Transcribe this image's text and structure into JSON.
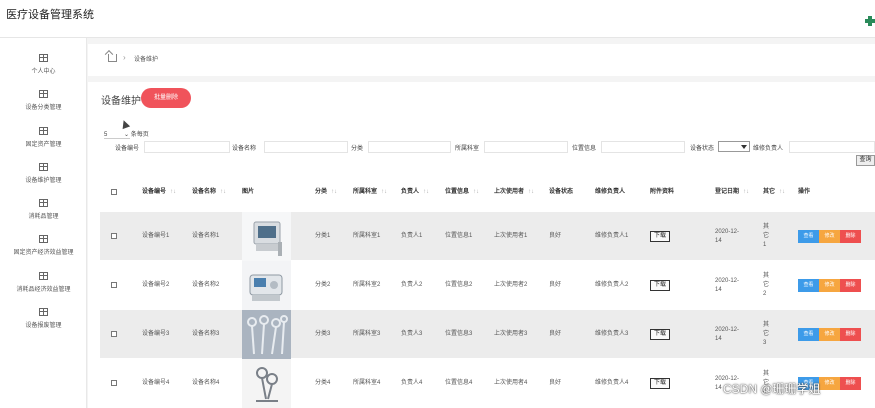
{
  "app": {
    "title": "医疗设备管理系统"
  },
  "sidebar": {
    "items": [
      {
        "label": "个人中心"
      },
      {
        "label": "设备分类管理"
      },
      {
        "label": "固定资产管理"
      },
      {
        "label": "设备维护管理"
      },
      {
        "label": "消耗品管理"
      },
      {
        "label": "固定资产经济效益管理"
      },
      {
        "label": "消耗品经济效益管理"
      },
      {
        "label": "设备报废管理"
      }
    ]
  },
  "breadcrumb": {
    "current": "设备维护"
  },
  "panel": {
    "title": "设备维护",
    "batch_delete": "批量删除"
  },
  "pagination": {
    "per_page_value": "5",
    "per_page_label": "条每页"
  },
  "filters": {
    "labels": [
      "设备编号",
      "设备名称",
      "分类",
      "所属科室",
      "位置信息",
      "设备状态",
      "维修负责人"
    ],
    "search_button": "查询"
  },
  "table": {
    "headers": [
      "设备编号",
      "设备名称",
      "图片",
      "分类",
      "所属科室",
      "负责人",
      "位置信息",
      "上次使用者",
      "设备状态",
      "维修负责人",
      "附件资料",
      "登记日期",
      "其它",
      "操作"
    ],
    "sort_glyph": "↑↓",
    "download_label": "下载",
    "actions": {
      "view": "查看",
      "edit": "修改",
      "delete": "删除"
    },
    "rows": [
      {
        "code": "设备编号1",
        "name": "设备名称1",
        "category": "分类1",
        "dept": "所属科室1",
        "owner": "负责人1",
        "location": "位置信息1",
        "last_user": "上次使用者1",
        "status": "良好",
        "repair_owner": "维修负责人1",
        "date": "2020-12-14",
        "other": "其它1"
      },
      {
        "code": "设备编号2",
        "name": "设备名称2",
        "category": "分类2",
        "dept": "所属科室2",
        "owner": "负责人2",
        "location": "位置信息2",
        "last_user": "上次使用者2",
        "status": "良好",
        "repair_owner": "维修负责人2",
        "date": "2020-12-14",
        "other": "其它2"
      },
      {
        "code": "设备编号3",
        "name": "设备名称3",
        "category": "分类3",
        "dept": "所属科室3",
        "owner": "负责人3",
        "location": "位置信息3",
        "last_user": "上次使用者3",
        "status": "良好",
        "repair_owner": "维修负责人3",
        "date": "2020-12-14",
        "other": "其它3"
      },
      {
        "code": "设备编号4",
        "name": "设备名称4",
        "category": "分类4",
        "dept": "所属科室4",
        "owner": "负责人4",
        "location": "位置信息4",
        "last_user": "上次使用者4",
        "status": "良好",
        "repair_owner": "维修负责人4",
        "date": "2020-12-14",
        "other": "其它4"
      }
    ]
  },
  "watermark": "CSDN @珊珊学姐",
  "colors": {
    "danger": "#f0535b",
    "primary": "#3d9be9",
    "warning": "#f6a640",
    "brand_icon": "#2a8a5a"
  }
}
